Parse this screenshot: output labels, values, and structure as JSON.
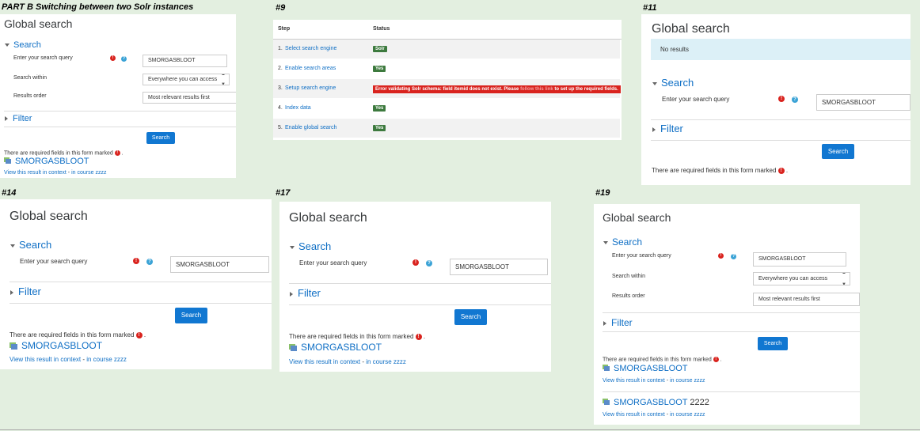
{
  "caption_main": "PART B Switching between two Solr instances",
  "captions": {
    "p9": "#9",
    "p11": "#11",
    "p14": "#14",
    "p17": "#17",
    "p19": "#19"
  },
  "common": {
    "page_title": "Global search",
    "search_section": "Search",
    "filter_section": "Filter",
    "query_label": "Enter your search query",
    "query_value": "SMORGASBLOOT",
    "within_label": "Search within",
    "within_value": "Everywhere you can access",
    "order_label": "Results order",
    "order_value": "Most relevant results first",
    "search_button": "Search",
    "required_text": "There are required fields in this form marked",
    "required_period": ".",
    "result_title": "SMORGASBLOOT",
    "context_link": "View this result in context",
    "context_sep": " - ",
    "course_link": "in course zzzz",
    "no_results": "No results",
    "result2_title": "SMORGASBLOOT",
    "result2_suffix": " 2222"
  },
  "status_table": {
    "headers": {
      "step": "Step",
      "status": "Status"
    },
    "rows": [
      {
        "num": "1.",
        "step": "Select search engine",
        "status": "Solr"
      },
      {
        "num": "2.",
        "step": "Enable search areas",
        "status": "Yes"
      },
      {
        "num": "3.",
        "step": "Setup search engine",
        "error_a": "Error validating Solr schema: field itemid does not exist. Please",
        "error_link": "follow this link",
        "error_b": "to set up the required fields."
      },
      {
        "num": "4.",
        "step": "Index data",
        "status": "Yes"
      },
      {
        "num": "5.",
        "step": "Enable global search",
        "status": "Yes"
      }
    ]
  },
  "colors": {
    "link": "#0f6fc5",
    "button": "#1177d1",
    "required": "#d9231e",
    "help": "#3ba3d6",
    "badge_ok": "#3d7a3e",
    "bg": "#e3efe0"
  }
}
